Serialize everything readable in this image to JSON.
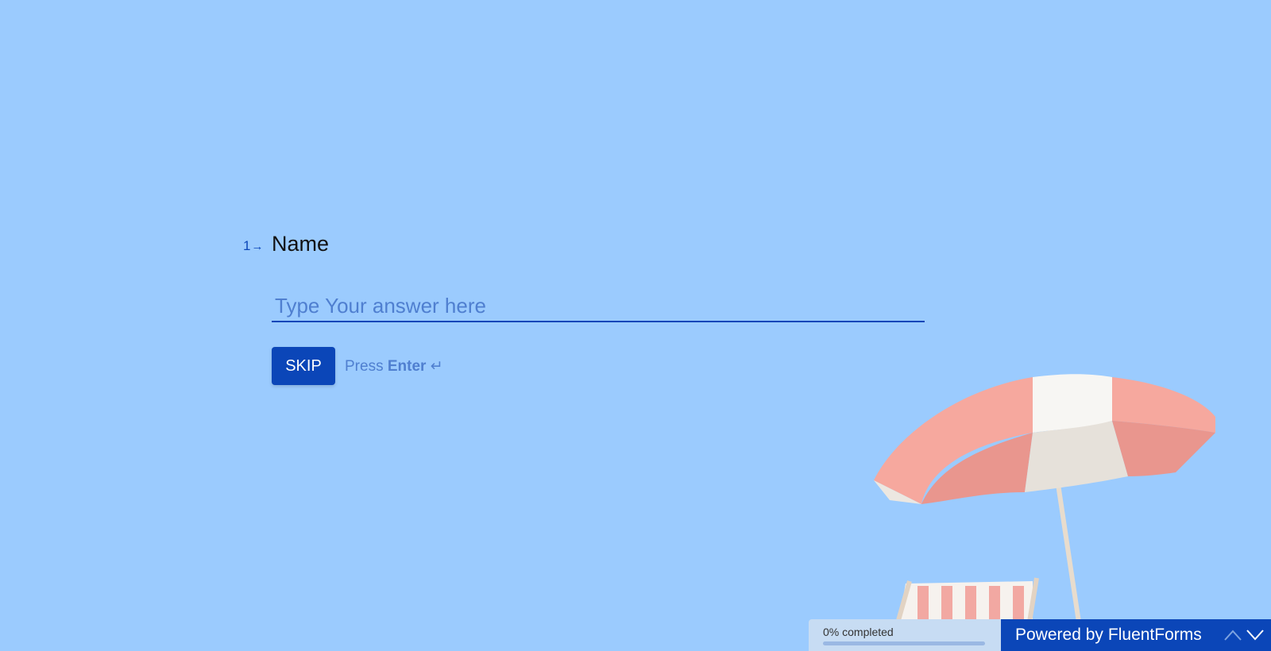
{
  "question": {
    "number": "1",
    "title": "Name",
    "placeholder": "Type Your answer here",
    "value": ""
  },
  "actions": {
    "skip_label": "SKIP",
    "hint_prefix": "Press",
    "hint_key": "Enter",
    "hint_icon": "↵"
  },
  "footer": {
    "progress_text": "0% completed",
    "progress_percent": 0,
    "powered_by": "Powered by",
    "brand": "FluentForms"
  },
  "colors": {
    "background": "#9bcbfe",
    "accent": "#0b46b8"
  }
}
